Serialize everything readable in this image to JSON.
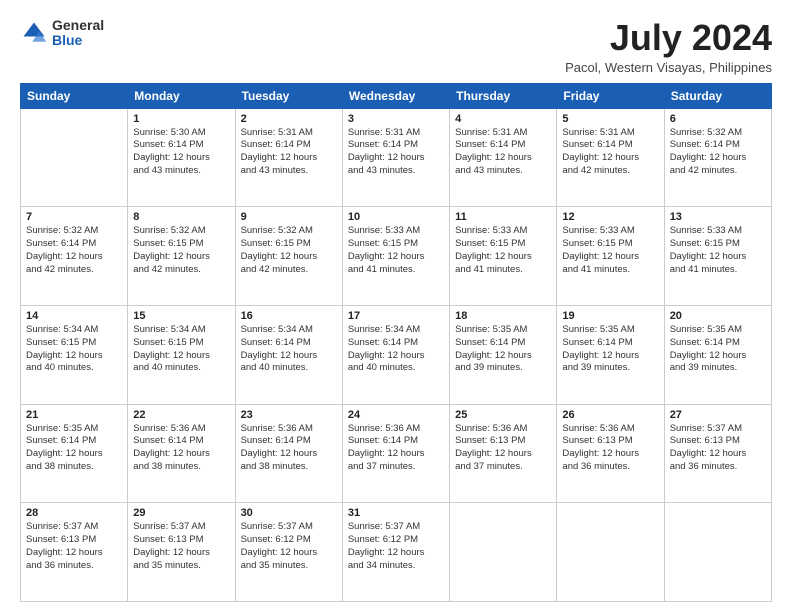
{
  "header": {
    "logo_general": "General",
    "logo_blue": "Blue",
    "title": "July 2024",
    "subtitle": "Pacol, Western Visayas, Philippines"
  },
  "days": [
    "Sunday",
    "Monday",
    "Tuesday",
    "Wednesday",
    "Thursday",
    "Friday",
    "Saturday"
  ],
  "weeks": [
    [
      {
        "num": "",
        "info": ""
      },
      {
        "num": "1",
        "info": "Sunrise: 5:30 AM\nSunset: 6:14 PM\nDaylight: 12 hours\nand 43 minutes."
      },
      {
        "num": "2",
        "info": "Sunrise: 5:31 AM\nSunset: 6:14 PM\nDaylight: 12 hours\nand 43 minutes."
      },
      {
        "num": "3",
        "info": "Sunrise: 5:31 AM\nSunset: 6:14 PM\nDaylight: 12 hours\nand 43 minutes."
      },
      {
        "num": "4",
        "info": "Sunrise: 5:31 AM\nSunset: 6:14 PM\nDaylight: 12 hours\nand 43 minutes."
      },
      {
        "num": "5",
        "info": "Sunrise: 5:31 AM\nSunset: 6:14 PM\nDaylight: 12 hours\nand 42 minutes."
      },
      {
        "num": "6",
        "info": "Sunrise: 5:32 AM\nSunset: 6:14 PM\nDaylight: 12 hours\nand 42 minutes."
      }
    ],
    [
      {
        "num": "7",
        "info": "Sunrise: 5:32 AM\nSunset: 6:14 PM\nDaylight: 12 hours\nand 42 minutes."
      },
      {
        "num": "8",
        "info": "Sunrise: 5:32 AM\nSunset: 6:15 PM\nDaylight: 12 hours\nand 42 minutes."
      },
      {
        "num": "9",
        "info": "Sunrise: 5:32 AM\nSunset: 6:15 PM\nDaylight: 12 hours\nand 42 minutes."
      },
      {
        "num": "10",
        "info": "Sunrise: 5:33 AM\nSunset: 6:15 PM\nDaylight: 12 hours\nand 41 minutes."
      },
      {
        "num": "11",
        "info": "Sunrise: 5:33 AM\nSunset: 6:15 PM\nDaylight: 12 hours\nand 41 minutes."
      },
      {
        "num": "12",
        "info": "Sunrise: 5:33 AM\nSunset: 6:15 PM\nDaylight: 12 hours\nand 41 minutes."
      },
      {
        "num": "13",
        "info": "Sunrise: 5:33 AM\nSunset: 6:15 PM\nDaylight: 12 hours\nand 41 minutes."
      }
    ],
    [
      {
        "num": "14",
        "info": "Sunrise: 5:34 AM\nSunset: 6:15 PM\nDaylight: 12 hours\nand 40 minutes."
      },
      {
        "num": "15",
        "info": "Sunrise: 5:34 AM\nSunset: 6:15 PM\nDaylight: 12 hours\nand 40 minutes."
      },
      {
        "num": "16",
        "info": "Sunrise: 5:34 AM\nSunset: 6:14 PM\nDaylight: 12 hours\nand 40 minutes."
      },
      {
        "num": "17",
        "info": "Sunrise: 5:34 AM\nSunset: 6:14 PM\nDaylight: 12 hours\nand 40 minutes."
      },
      {
        "num": "18",
        "info": "Sunrise: 5:35 AM\nSunset: 6:14 PM\nDaylight: 12 hours\nand 39 minutes."
      },
      {
        "num": "19",
        "info": "Sunrise: 5:35 AM\nSunset: 6:14 PM\nDaylight: 12 hours\nand 39 minutes."
      },
      {
        "num": "20",
        "info": "Sunrise: 5:35 AM\nSunset: 6:14 PM\nDaylight: 12 hours\nand 39 minutes."
      }
    ],
    [
      {
        "num": "21",
        "info": "Sunrise: 5:35 AM\nSunset: 6:14 PM\nDaylight: 12 hours\nand 38 minutes."
      },
      {
        "num": "22",
        "info": "Sunrise: 5:36 AM\nSunset: 6:14 PM\nDaylight: 12 hours\nand 38 minutes."
      },
      {
        "num": "23",
        "info": "Sunrise: 5:36 AM\nSunset: 6:14 PM\nDaylight: 12 hours\nand 38 minutes."
      },
      {
        "num": "24",
        "info": "Sunrise: 5:36 AM\nSunset: 6:14 PM\nDaylight: 12 hours\nand 37 minutes."
      },
      {
        "num": "25",
        "info": "Sunrise: 5:36 AM\nSunset: 6:13 PM\nDaylight: 12 hours\nand 37 minutes."
      },
      {
        "num": "26",
        "info": "Sunrise: 5:36 AM\nSunset: 6:13 PM\nDaylight: 12 hours\nand 36 minutes."
      },
      {
        "num": "27",
        "info": "Sunrise: 5:37 AM\nSunset: 6:13 PM\nDaylight: 12 hours\nand 36 minutes."
      }
    ],
    [
      {
        "num": "28",
        "info": "Sunrise: 5:37 AM\nSunset: 6:13 PM\nDaylight: 12 hours\nand 36 minutes."
      },
      {
        "num": "29",
        "info": "Sunrise: 5:37 AM\nSunset: 6:13 PM\nDaylight: 12 hours\nand 35 minutes."
      },
      {
        "num": "30",
        "info": "Sunrise: 5:37 AM\nSunset: 6:12 PM\nDaylight: 12 hours\nand 35 minutes."
      },
      {
        "num": "31",
        "info": "Sunrise: 5:37 AM\nSunset: 6:12 PM\nDaylight: 12 hours\nand 34 minutes."
      },
      {
        "num": "",
        "info": ""
      },
      {
        "num": "",
        "info": ""
      },
      {
        "num": "",
        "info": ""
      }
    ]
  ]
}
